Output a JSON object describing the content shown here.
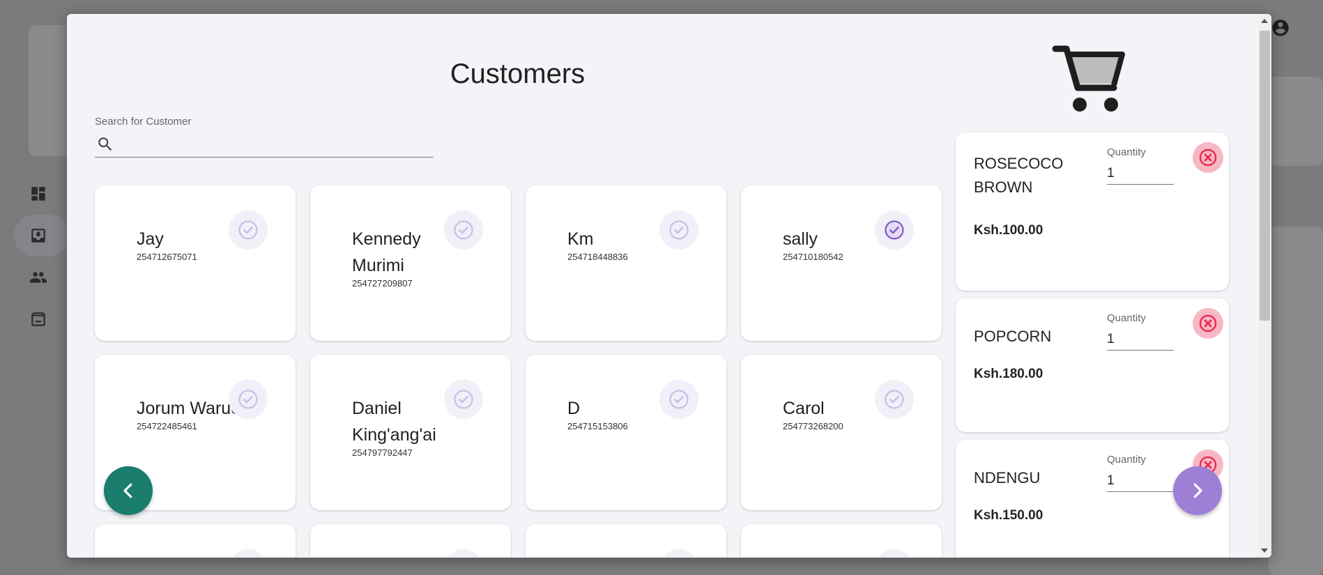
{
  "modal": {
    "title": "Customers",
    "search": {
      "label": "Search for Customer",
      "value": "",
      "placeholder": ""
    }
  },
  "customers": [
    {
      "name": "Jay",
      "phone": "254712675071",
      "selected": false
    },
    {
      "name": "Kennedy Murimi",
      "phone": "254727209807",
      "selected": false
    },
    {
      "name": "Km",
      "phone": "254718448836",
      "selected": false
    },
    {
      "name": "sally",
      "phone": "254710180542",
      "selected": true
    },
    {
      "name": "Jorum Waruo",
      "phone": "254722485461",
      "selected": false
    },
    {
      "name": "Daniel King'ang'ai",
      "phone": "254797792447",
      "selected": false
    },
    {
      "name": "D",
      "phone": "254715153806",
      "selected": false
    },
    {
      "name": "Carol",
      "phone": "254773268200",
      "selected": false
    }
  ],
  "cart": {
    "items": [
      {
        "name": "ROSECOCO BROWN",
        "quantity_label": "Quantity",
        "quantity": "1",
        "price": "Ksh.100.00"
      },
      {
        "name": "POPCORN",
        "quantity_label": "Quantity",
        "quantity": "1",
        "price": "Ksh.180.00"
      },
      {
        "name": "NDENGU",
        "quantity_label": "Quantity",
        "quantity": "1",
        "price": "Ksh.150.00"
      }
    ]
  },
  "colors": {
    "accent": "#9e7fd6",
    "prev_fab": "#1a7d6e",
    "remove": "#e8284f",
    "check_selected": "#7e5fc4",
    "check_unselected": "#cbbde8"
  },
  "icons": {
    "search": "search-icon",
    "cart": "shopping-cart-icon",
    "check": "check-circle-icon",
    "remove": "cancel-icon",
    "prev": "chevron-left-icon",
    "next": "chevron-right-icon"
  }
}
